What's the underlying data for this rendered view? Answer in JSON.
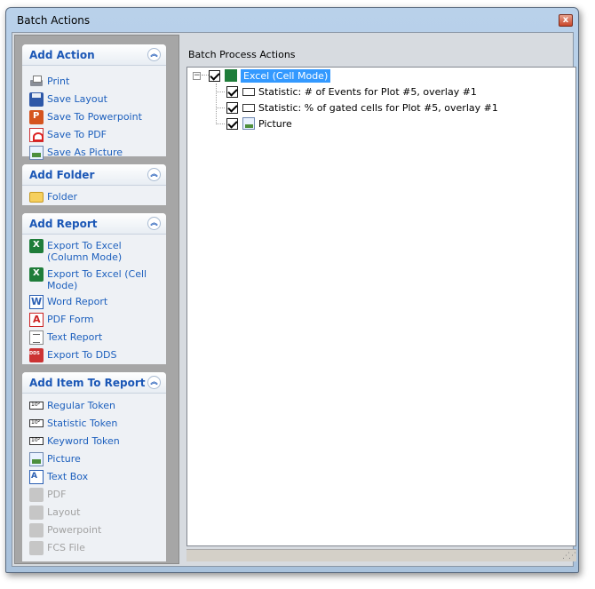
{
  "window": {
    "title": "Batch Actions",
    "close_glyph": "x"
  },
  "task_groups": [
    {
      "title": "Add Action",
      "items": [
        {
          "label": "Print",
          "icon": "printer-icon"
        },
        {
          "label": "Save Layout",
          "icon": "save-icon"
        },
        {
          "label": "Save To Powerpoint",
          "icon": "powerpoint-icon"
        },
        {
          "label": "Save To PDF",
          "icon": "pdf-icon"
        },
        {
          "label": "Save As Picture",
          "icon": "picture-icon"
        }
      ]
    },
    {
      "title": "Add Folder",
      "items": [
        {
          "label": "Folder",
          "icon": "folder-icon"
        }
      ]
    },
    {
      "title": "Add Report",
      "items": [
        {
          "label": "Export To Excel (Column Mode)",
          "icon": "excel-icon"
        },
        {
          "label": "Export To Excel (Cell Mode)",
          "icon": "excel-icon"
        },
        {
          "label": "Word Report",
          "icon": "word-icon"
        },
        {
          "label": "PDF Form",
          "icon": "pdf-form-icon"
        },
        {
          "label": "Text Report",
          "icon": "text-report-icon"
        },
        {
          "label": "Export To DDS",
          "icon": "dds-icon"
        }
      ]
    },
    {
      "title": "Add Item To Report",
      "items": [
        {
          "label": "Regular Token",
          "icon": "token-icon",
          "enabled": true
        },
        {
          "label": "Statistic Token",
          "icon": "token-icon",
          "enabled": true
        },
        {
          "label": "Keyword Token",
          "icon": "token-icon",
          "enabled": true
        },
        {
          "label": "Picture",
          "icon": "picture-icon",
          "enabled": true
        },
        {
          "label": "Text Box",
          "icon": "text-box-icon",
          "enabled": true
        },
        {
          "label": "PDF",
          "icon": "pdf-icon",
          "enabled": false
        },
        {
          "label": "Layout",
          "icon": "layout-icon",
          "enabled": false
        },
        {
          "label": "Powerpoint",
          "icon": "powerpoint-icon",
          "enabled": false
        },
        {
          "label": "FCS File",
          "icon": "fcs-file-icon",
          "enabled": false
        }
      ]
    }
  ],
  "right_pane": {
    "header": "Batch Process Actions",
    "tree": {
      "root": {
        "label": "Excel (Cell Mode)",
        "checked": true,
        "selected": true,
        "expander": "−"
      },
      "children": [
        {
          "label": "Statistic: # of Events for Plot #5, overlay #1",
          "checked": true,
          "icon": "token-icon"
        },
        {
          "label": "Statistic: % of gated cells for Plot #5, overlay #1",
          "checked": true,
          "icon": "token-icon"
        },
        {
          "label": "Picture",
          "checked": true,
          "icon": "picture-icon"
        }
      ]
    }
  },
  "colors": {
    "link_blue": "#1c5fbd",
    "group_title_blue": "#1b57b6",
    "selection": "#3399ff",
    "disabled_gray": "#a2a2a2"
  }
}
